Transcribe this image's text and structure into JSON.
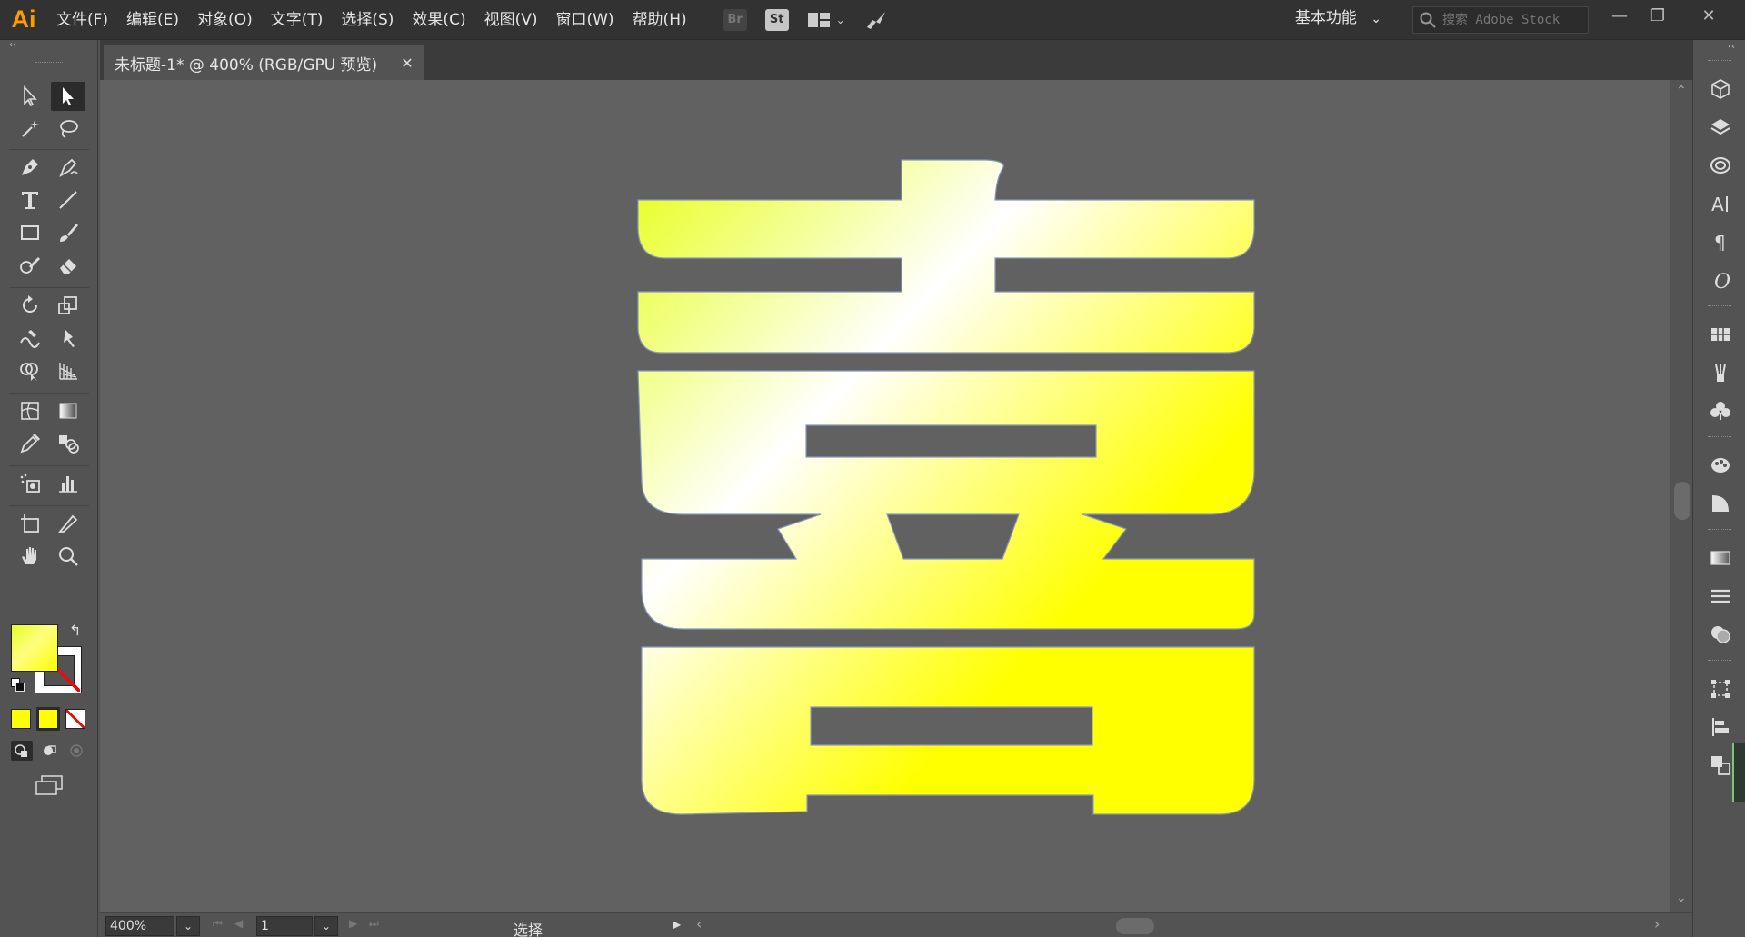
{
  "app": {
    "logo": "Ai",
    "menu": [
      "文件(F)",
      "编辑(E)",
      "对象(O)",
      "文字(T)",
      "选择(S)",
      "效果(C)",
      "视图(V)",
      "窗口(W)",
      "帮助(H)"
    ],
    "bridge_badge": "Br",
    "stock_badge": "St",
    "workspace_label": "基本功能",
    "search_placeholder": "搜索 Adobe Stock"
  },
  "document": {
    "tab_title": "未标题-1* @ 400% (RGB/GPU 预览)",
    "artwork_glyph": "喜",
    "gradient_colors": [
      "#e6ff1a",
      "#ffffff",
      "#ffff00"
    ]
  },
  "status": {
    "zoom": "400%",
    "page": "1",
    "tool_text": "选择"
  },
  "colors": {
    "fill_gradient": [
      "#e6ff20",
      "#fffd80",
      "#ffff00"
    ],
    "stroke": "none",
    "accent": "#ff9a00"
  },
  "icons": {
    "left_tools": [
      "selection-tool",
      "direct-selection-tool",
      "magic-wand-tool",
      "lasso-tool",
      "pen-tool",
      "curvature-tool",
      "type-tool",
      "line-tool",
      "rectangle-tool",
      "paintbrush-tool",
      "shaper-tool",
      "eraser-tool",
      "rotate-tool",
      "scale-tool",
      "warp-tool",
      "puppet-warp-tool",
      "shape-builder-tool",
      "perspective-grid-tool",
      "mesh-tool",
      "gradient-tool",
      "eyedropper-tool",
      "blend-tool",
      "symbol-sprayer-tool",
      "column-graph-tool",
      "artboard-tool",
      "slice-tool",
      "hand-tool",
      "zoom-tool"
    ],
    "right_panels": [
      "libraries-panel",
      "layers-panel",
      "cc-libraries-panel",
      "character-panel",
      "paragraph-panel",
      "opentype-panel",
      "swatches-panel",
      "brushes-panel",
      "symbols-panel",
      "color-guide-panel",
      "color-panel",
      "gradient-panel",
      "stroke-panel",
      "transparency-panel",
      "transform-panel",
      "align-panel",
      "pathfinder-panel"
    ]
  }
}
